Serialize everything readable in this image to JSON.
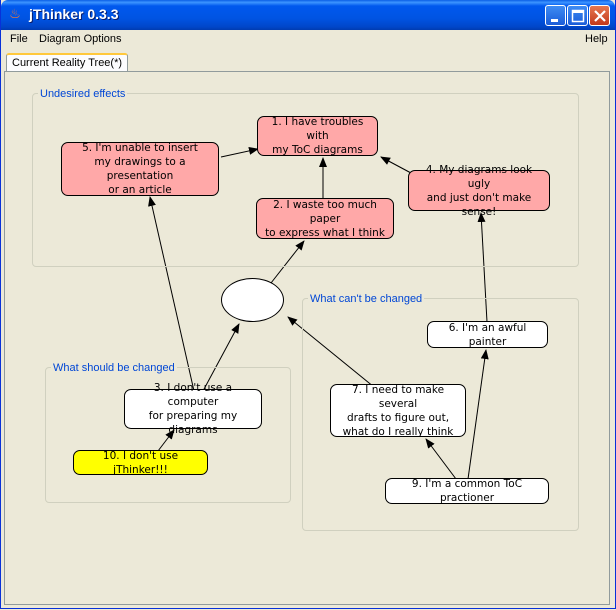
{
  "window": {
    "title": "jThinker 0.3.3"
  },
  "menu": {
    "file": "File",
    "diagram_options": "Diagram Options",
    "help": "Help"
  },
  "tab": {
    "label": "Current Reality Tree(*)"
  },
  "groups": {
    "undesired": "Undesired effects",
    "cant_change": "What can't be changed",
    "should_change": "What should be changed"
  },
  "nodes": {
    "n1": "1. I have troubles with\nmy ToC diagrams",
    "n2": "2. I waste too much paper\nto express what I think",
    "n3": "3. I don't use a computer\nfor preparing my diagrams",
    "n4": "4. My diagrams look ugly\nand just don't make sense!",
    "n5": "5. I'm unable to insert\nmy drawings to a presentation\nor an article",
    "n6": "6. I'm an awful painter",
    "n7": "7. I need to make several\ndrafts to figure out,\nwhat do I really think",
    "n9": "9. I'm a common ToC practioner",
    "n10": "10. I don't use jThinker!!!"
  },
  "colors": {
    "undesired_fill": "#FFA8A8",
    "highlight_fill": "#FFFF00",
    "neutral_fill": "#FFFFFF",
    "group_label": "#0046D5"
  }
}
